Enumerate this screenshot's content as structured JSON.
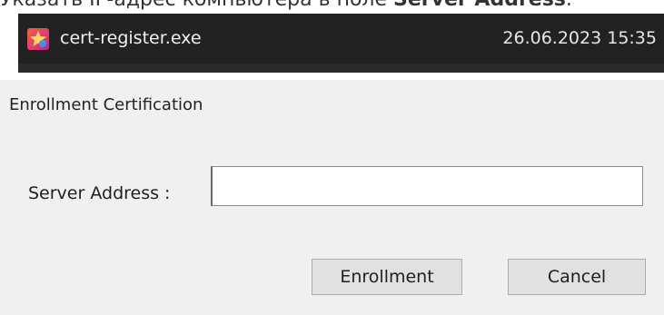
{
  "caption": {
    "text_before": "Указать IP-адрес компьютера в поле ",
    "text_bold": "Server Address",
    "text_after": "."
  },
  "file_row": {
    "icon": "app-icon",
    "name": "cert-register.exe",
    "date": "26.06.2023 15:35"
  },
  "dialog": {
    "title": "Enrollment Certification",
    "server_label": "Server Address :",
    "server_value": "",
    "enroll_label": "Enrollment",
    "cancel_label": "Cancel"
  },
  "colors": {
    "file_bar_bg": "#222222",
    "dialog_bg": "#f0f0f0",
    "button_bg": "#e1e1e1",
    "icon_accent": "#e03d6d"
  }
}
